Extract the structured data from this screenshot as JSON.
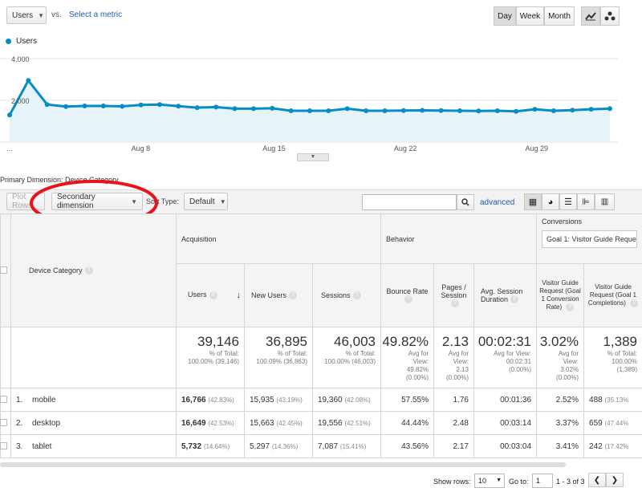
{
  "metric_bar": {
    "metric": "Users",
    "vs": "vs.",
    "select_metric": "Select a metric"
  },
  "time_buttons": [
    "Day",
    "Week",
    "Month"
  ],
  "chart_data": {
    "type": "area",
    "series": [
      {
        "name": "Users",
        "values": [
          1300,
          2950,
          1800,
          1700,
          1730,
          1730,
          1710,
          1780,
          1800,
          1720,
          1650,
          1680,
          1600,
          1600,
          1620,
          1500,
          1500,
          1500,
          1600,
          1500,
          1500,
          1510,
          1520,
          1510,
          1500,
          1490,
          1500,
          1470,
          1570,
          1500,
          1530,
          1570,
          1600
        ]
      }
    ],
    "y_ticks": [
      "4,000",
      "2,000"
    ],
    "ylim": [
      0,
      4000
    ],
    "x_ticks": [
      "...",
      "Aug 8",
      "Aug 15",
      "Aug 22",
      "Aug 29"
    ],
    "color": "#058dc7"
  },
  "primary_dimension": {
    "label": "Primary Dimension:",
    "value": "Device Category"
  },
  "toolbar": {
    "plot_rows": "Plot Rows",
    "secondary_dimension": "Secondary dimension",
    "sort_type_label": "Sort Type:",
    "sort_type_value": "Default",
    "advanced": "advanced"
  },
  "table": {
    "groups": {
      "acquisition": "Acquisition",
      "behavior": "Behavior",
      "conversions": "Conversions",
      "goal_select": "Goal 1: Visitor Guide Reques"
    },
    "dimension_header": "Device Category",
    "columns": [
      "Users",
      "New Users",
      "Sessions",
      "Bounce Rate",
      "Pages / Session",
      "Avg. Session Duration",
      "Visitor Guide Request (Goal 1 Conversion Rate)",
      "Visitor Guide Request (Goal 1 Completions)"
    ],
    "totals": [
      {
        "big": "39,146",
        "sub": [
          "% of Total:",
          "100.00% (39,146)"
        ]
      },
      {
        "big": "36,895",
        "sub": [
          "% of Total:",
          "100.09% (36,863)"
        ]
      },
      {
        "big": "46,003",
        "sub": [
          "% of Total:",
          "100.00% (46,003)"
        ]
      },
      {
        "big": "49.82%",
        "sub": [
          "Avg for",
          "View:",
          "49.82%",
          "(0.00%)"
        ]
      },
      {
        "big": "2.13",
        "sub": [
          "Avg for",
          "View:",
          "2.13",
          "(0.00%)"
        ]
      },
      {
        "big": "00:02:31",
        "sub": [
          "Avg for View:",
          "00:02:31",
          "(0.00%)"
        ]
      },
      {
        "big": "3.02%",
        "sub": [
          "Avg for",
          "View:",
          "3.02%",
          "(0.00%)"
        ]
      },
      {
        "big": "1,389",
        "sub": [
          "% of Total:",
          "100.00%",
          "(1,389)"
        ]
      }
    ],
    "rows": [
      {
        "idx": "1.",
        "name": "mobile",
        "cells": [
          [
            "16,766",
            "(42.83%)"
          ],
          [
            "15,935",
            "(43.19%)"
          ],
          [
            "19,360",
            "(42.08%)"
          ],
          [
            "57.55%",
            ""
          ],
          [
            "1.76",
            ""
          ],
          [
            "00:01:36",
            ""
          ],
          [
            "2.52%",
            ""
          ],
          [
            "488",
            "(35.13%"
          ]
        ]
      },
      {
        "idx": "2.",
        "name": "desktop",
        "cells": [
          [
            "16,649",
            "(42.53%)"
          ],
          [
            "15,663",
            "(42.45%)"
          ],
          [
            "19,556",
            "(42.51%)"
          ],
          [
            "44.44%",
            ""
          ],
          [
            "2.48",
            ""
          ],
          [
            "00:03:14",
            ""
          ],
          [
            "3.37%",
            ""
          ],
          [
            "659",
            "(47.44%"
          ]
        ]
      },
      {
        "idx": "3.",
        "name": "tablet",
        "cells": [
          [
            "5,732",
            "(14.64%)"
          ],
          [
            "5,297",
            "(14.36%)"
          ],
          [
            "7,087",
            "(15.41%)"
          ],
          [
            "43.56%",
            ""
          ],
          [
            "2.17",
            ""
          ],
          [
            "00:03:04",
            ""
          ],
          [
            "3.41%",
            ""
          ],
          [
            "242",
            "(17.42%"
          ]
        ]
      }
    ]
  },
  "pagination": {
    "show_rows_label": "Show rows:",
    "show_rows_value": "10",
    "goto_label": "Go to:",
    "goto_value": "1",
    "range": "1 - 3 of 3"
  }
}
